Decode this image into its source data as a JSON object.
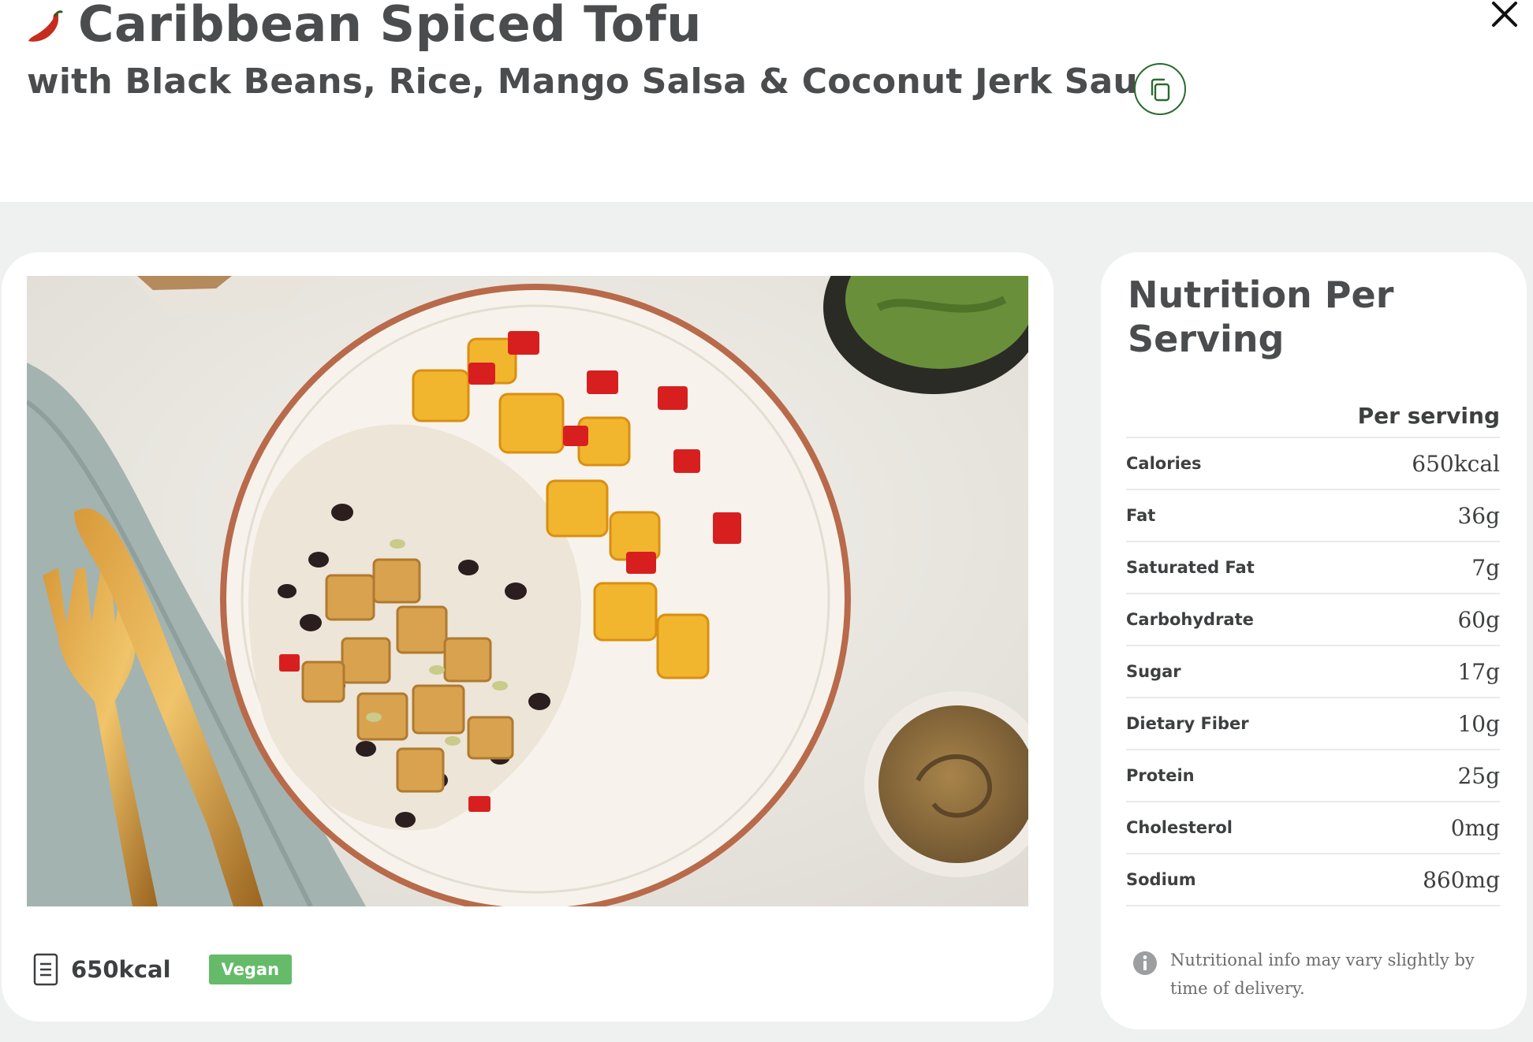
{
  "header": {
    "title": "Caribbean Spiced Tofu",
    "subtitle": "with Black Beans, Rice, Mango Salsa & Coconut Jerk Sauce",
    "spicy_icon": "chili-pepper-icon",
    "copy_icon": "copy-icon",
    "close_icon": "close-icon"
  },
  "meal_card": {
    "photo": "dish-photo",
    "calories": "650kcal",
    "calories_icon": "document-icon",
    "badge": "Vegan"
  },
  "nutrition": {
    "title": "Nutrition Per Serving",
    "column_header": "Per serving",
    "rows": [
      {
        "label": "Calories",
        "value": "650kcal"
      },
      {
        "label": "Fat",
        "value": "36g"
      },
      {
        "label": "Saturated Fat",
        "value": "7g"
      },
      {
        "label": "Carbohydrate",
        "value": "60g"
      },
      {
        "label": "Sugar",
        "value": "17g"
      },
      {
        "label": "Dietary Fiber",
        "value": "10g"
      },
      {
        "label": "Protein",
        "value": "25g"
      },
      {
        "label": "Cholesterol",
        "value": "0mg"
      },
      {
        "label": "Sodium",
        "value": "860mg"
      }
    ],
    "note": "Nutritional info may vary slightly by time of delivery.",
    "note_icon": "info-icon"
  },
  "colors": {
    "accent_green": "#2a6b2f",
    "badge_green": "#66bb6a",
    "chili_red": "#c62d1f",
    "text_dark": "#4a4c4d",
    "page_gray": "#eff1f0"
  }
}
